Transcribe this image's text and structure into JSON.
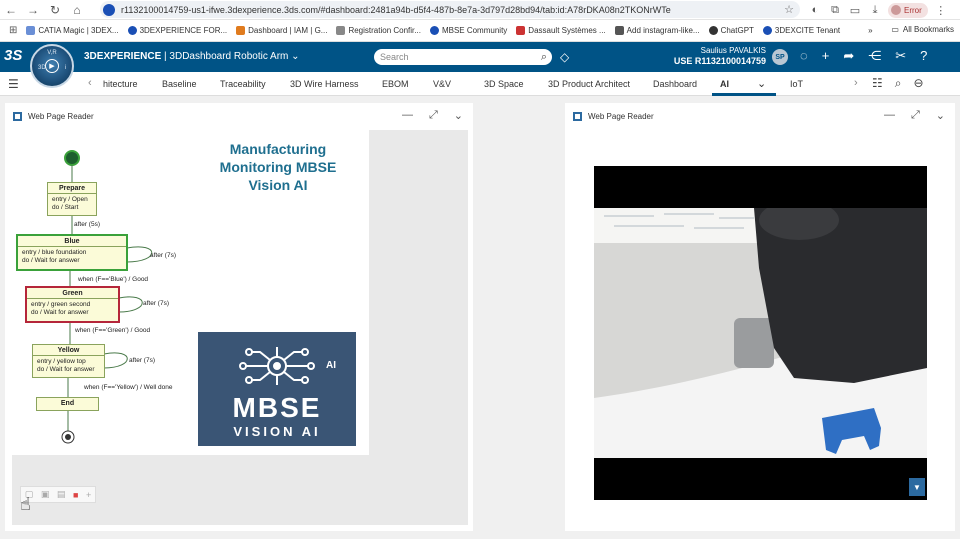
{
  "browser": {
    "url": "r1132100014759-us1-ifwe.3dexperience.3ds.com/#dashboard:2481a94b-d5f4-487b-8e7a-3d797d28bd94/tab:id:A78rDKA08n2TKONrWTe",
    "error_label": "Error",
    "bookmarks": [
      {
        "label": "CATIA Magic | 3DEX...",
        "color": "#6a8fd6"
      },
      {
        "label": "3DEXPERIENCE FOR...",
        "color": "#1a4fb5"
      },
      {
        "label": "Dashboard | IAM | G...",
        "color": "#e07b1e"
      },
      {
        "label": "Registration Confir...",
        "color": "#888888"
      },
      {
        "label": "MBSE Community",
        "color": "#1a4fb5"
      },
      {
        "label": "Dassault Systèmes ...",
        "color": "#cc3333"
      },
      {
        "label": "Add instagram-like...",
        "color": "#555555"
      },
      {
        "label": "ChatGPT",
        "color": "#333333"
      },
      {
        "label": "3DEXCITE Tenant",
        "color": "#1a4fb5"
      }
    ],
    "all_bookmarks_label": "All Bookmarks"
  },
  "topbar": {
    "brand": "3DEXPERIENCE",
    "app": "3DDashboard",
    "dashboard_name": "Robotic Arm",
    "search_placeholder": "Search",
    "user_name": "Saulius PAVALKIS",
    "context": "USE R1132100014759",
    "avatar_initials": "SP",
    "compass_label": "V,R"
  },
  "tabs": {
    "items": [
      "hitecture",
      "Baseline",
      "Traceability",
      "3D Wire Harness",
      "EBOM",
      "V&V",
      "3D Space",
      "3D Product Architect",
      "Dashboard",
      "AI",
      "IoT"
    ],
    "active": "AI"
  },
  "widgets": {
    "left": {
      "title": "Web Page Reader",
      "diagram": {
        "title": "Manufacturing Monitoring MBSE Vision AI",
        "states": [
          {
            "name": "Prepare",
            "lines": [
              "entry / Open",
              "do / Start"
            ]
          },
          {
            "name": "Blue",
            "lines": [
              "entry / blue foundation",
              "do / Wait  for answer"
            ]
          },
          {
            "name": "Green",
            "lines": [
              "entry / green second",
              "do / Wait  for answer"
            ]
          },
          {
            "name": "Yellow",
            "lines": [
              "entry / yellow  top",
              "do / Wait  for answer"
            ]
          },
          {
            "name": "End",
            "lines": []
          }
        ],
        "transitions": [
          "after (5s)",
          "after (7s)",
          "when (F=='Blue') / Good",
          "after (7s)",
          "when (F=='Green') / Good",
          "after (7s)",
          "when (F=='Yellow') / Well done"
        ]
      },
      "logo": {
        "ai_small": "AI",
        "big": "MBSE",
        "sub": "VISION AI"
      }
    },
    "right": {
      "title": "Web Page Reader"
    }
  }
}
